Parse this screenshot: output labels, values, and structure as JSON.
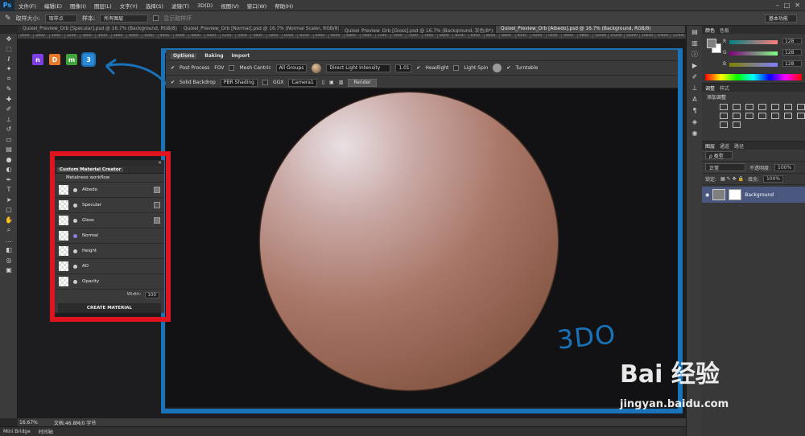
{
  "menubar": {
    "logo": "Ps",
    "items": [
      "文件(F)",
      "编辑(E)",
      "图像(I)",
      "图层(L)",
      "文字(Y)",
      "选择(S)",
      "滤镜(T)",
      "3D(D)",
      "视图(V)",
      "窗口(W)",
      "帮助(H)"
    ]
  },
  "options": {
    "size_label": "取样大小:",
    "size_value": "取样点",
    "sample_label": "样本:",
    "sample_value": "所有图层",
    "ring_label": "显示取样环",
    "workspace": "基本功能"
  },
  "doc_tabs": [
    "Quixel_Preview_Orb [Specular].psd @ 16.7% (Background, RGB/8)",
    "Quixel_Preview_Orb [Normal].psd @ 16.7% (Normal Scaler, RGB/8)",
    "Quixel_Preview_Orb [Gloss].psd @ 16.7% (Background, 灰色/8*)",
    "Quixel_Preview_Orb [Albedo].psd @ 16.7% (Background, RGB/8)"
  ],
  "ruler": [
    "2600",
    "2800",
    "3000",
    "3200",
    "3400",
    "3600",
    "3800",
    "4000",
    "4200",
    "4400",
    "4600",
    "4800",
    "5000",
    "5200",
    "5400",
    "5600",
    "5800",
    "6000",
    "6200",
    "6400",
    "6600",
    "6800",
    "7000",
    "7200",
    "7400",
    "7600",
    "7800",
    "8000",
    "8200",
    "8400",
    "8600",
    "8800",
    "9000",
    "9200",
    "9400",
    "9600",
    "9800",
    "10000",
    "10200",
    "10400",
    "10600",
    "10800",
    "11000"
  ],
  "badges": [
    {
      "letter": "n",
      "color": "#7b3fe4"
    },
    {
      "letter": "D",
      "color": "#e8782a"
    },
    {
      "letter": "m",
      "color": "#3fa43a"
    },
    {
      "letter": "3",
      "color": "#2a8ad8"
    }
  ],
  "tdo": {
    "tabs": [
      "Options",
      "Baking",
      "Import"
    ],
    "post_process": "Post Process",
    "fov": "FOV",
    "mesh_centric": "Mesh Centric",
    "groups": "All Groups",
    "light_label": "Direct Light Intensity",
    "light_value": "1.01",
    "headlight": "Headlight",
    "light_spin": "Light Spin",
    "turntable": "Turntable",
    "solid_backdrop": "Solid Backdrop",
    "shading": "PBR Shading",
    "ggx": "GGX",
    "camera": "Camera1",
    "render": "Render"
  },
  "cmc": {
    "title": "Custom Material Creator",
    "workflow": "Metalness workflow",
    "rows": [
      "Albedo",
      "Specular",
      "Gloss",
      "Normal",
      "Height",
      "AO",
      "Opacity"
    ],
    "width_label": "Width:",
    "width_value": "100",
    "create": "CREATE MATERIAL"
  },
  "status": {
    "zoom": "16.67%",
    "doc": "文档:46.8M/0 字节"
  },
  "minibridge": {
    "tab1": "Mini Bridge",
    "tab2": "时间轴"
  },
  "color_panel": {
    "tabs": [
      "颜色",
      "色板"
    ],
    "r_label": "R",
    "r_value": "128",
    "g_label": "G",
    "g_value": "128",
    "b_label": "B",
    "b_value": "128"
  },
  "adjust_panel": {
    "tabs": [
      "调整",
      "样式"
    ],
    "label": "添加调整"
  },
  "layers_panel": {
    "tabs": [
      "图层",
      "通道",
      "路径"
    ],
    "kind": "ρ 类型",
    "mode": "正常",
    "opacity_label": "不透明度:",
    "opacity_value": "100%",
    "lock_label": "锁定:",
    "fill_label": "填充:",
    "fill_value": "100%",
    "layer_name": "Background"
  },
  "annotation": {
    "logo_text": "3DO"
  },
  "watermark": {
    "brand": "Bai 经验",
    "url": "jingyan.baidu.com"
  }
}
